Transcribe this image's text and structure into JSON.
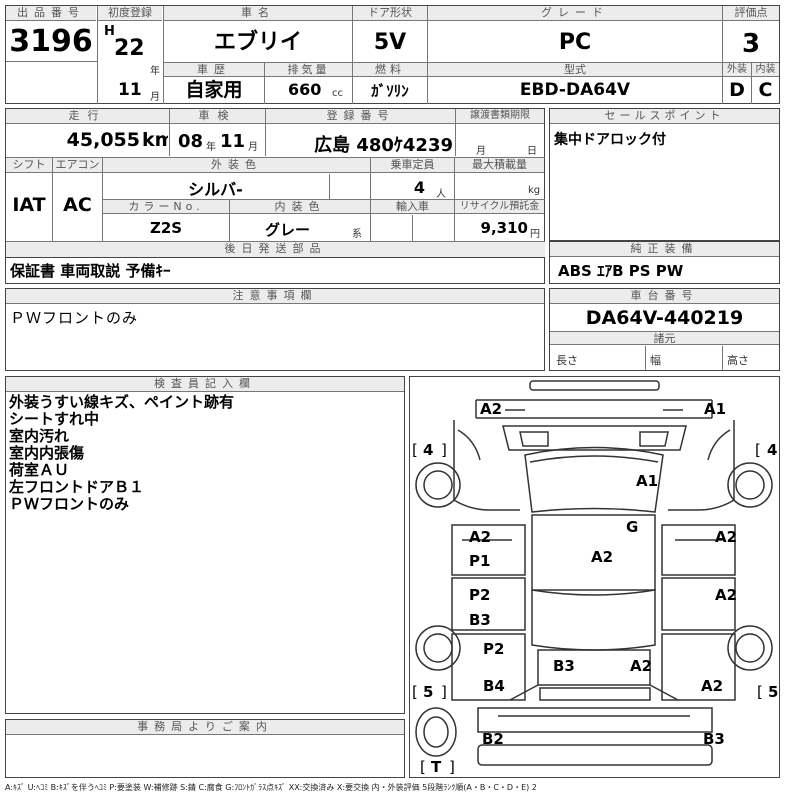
{
  "header": {
    "lot_no_label": "出品番号",
    "lot_no": "3196",
    "first_reg_label": "初度登録",
    "era": "H",
    "year": "22",
    "year_unit": "年",
    "month": "11",
    "month_unit": "月",
    "car_name_label": "車名",
    "car_name": "エブリイ",
    "door_label": "ドア形状",
    "door": "5V",
    "grade_label": "グレード",
    "grade": "PC",
    "score_label": "評価点",
    "score": "3",
    "history_label": "車歴",
    "history": "自家用",
    "displacement_label": "排気量",
    "displacement": "660",
    "displacement_unit": "cc",
    "fuel_label": "燃料",
    "fuel": "ｶﾞｿﾘﾝ",
    "model_label": "型式",
    "model": "EBD-DA64V",
    "exterior_label": "外装",
    "exterior": "D",
    "interior_label": "内装",
    "interior": "C"
  },
  "row2": {
    "mileage_label": "走行",
    "mileage": "45,055",
    "mileage_unit": "km",
    "inspection_label": "車検",
    "insp_year": "08",
    "insp_year_unit": "年",
    "insp_month": "11",
    "insp_month_unit": "月",
    "plate_label": "登録番号",
    "plate": "広島 480ｹ4239",
    "transfer_label": "譲渡書類期限",
    "transfer_month_unit": "月",
    "transfer_day_unit": "日",
    "sales_point_label": "セールスポイント",
    "sales_point": "集中ドアロック付",
    "shift_label": "シフト",
    "shift": "IAT",
    "aircon_label": "エアコン",
    "aircon": "AC",
    "color_label": "外装色",
    "color": "シルバ-",
    "capacity_label": "乗車定員",
    "capacity": "4",
    "capacity_unit": "人",
    "max_load_label": "最大積載量",
    "max_load_unit": "kg",
    "color_no_label": "カラーNo.",
    "color_no": "Z2S",
    "int_color_label": "内装色",
    "int_color": "グレー",
    "int_color_suffix": "系",
    "import_label": "輸入車",
    "recycle_label": "リサイクル預託金",
    "recycle": "9,310",
    "recycle_unit": "円"
  },
  "later_parts": {
    "label": "後日発送部品",
    "value": "保証書 車両取説 予備ｷｰ"
  },
  "genuine": {
    "label": "純正装備",
    "value": "ABS ｴｱB PS PW"
  },
  "caution": {
    "label": "注意事項欄",
    "value": "ＰＷフロントのみ"
  },
  "chassis": {
    "label": "車台番号",
    "value": "DA64V-440219",
    "dims_label": "諸元",
    "length_label": "長さ",
    "width_label": "幅",
    "height_label": "高さ"
  },
  "inspector": {
    "label": "検査員記入欄",
    "lines": [
      "外装うすい線キズ、ペイント跡有",
      "シートすれ中",
      "室内汚れ",
      "室内内張傷",
      "荷室ＡＵ",
      "左フロントドアＢ１",
      "ＰＷフロントのみ"
    ]
  },
  "office": {
    "label": "事務局よりご案内"
  },
  "diagram": {
    "marks": [
      "A2",
      "A1",
      "A1",
      "G",
      "A2",
      "P1",
      "A2",
      "A2",
      "P2",
      "B3",
      "A2",
      "P2",
      "B3",
      "A2",
      "B4",
      "A2",
      "B2",
      "B3"
    ],
    "tires": [
      "4",
      "4",
      "5",
      "5",
      "T"
    ]
  },
  "legend": "A:ｷｽﾞ U:ﾍｺﾐ B:ｷｽﾞを伴うﾍｺﾐ P:要塗装 W:補修跡 S:錆 C:腐食 G:ﾌﾛﾝﾄｶﾞﾗｽ点ｷｽﾞ XX:交換済み X:要交換 内・外装評価 5段階ﾗﾝｸ順(A・B・C・D・E) 2"
}
